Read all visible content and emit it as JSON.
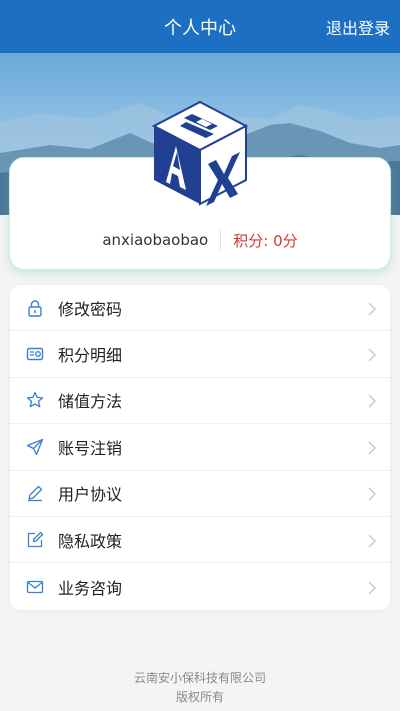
{
  "header": {
    "title": "个人中心",
    "logout_label": "退出登录",
    "bg_color": "#1d6fc3"
  },
  "profile": {
    "username": "anxiaobaobao",
    "points_label": "积分:",
    "points_value": "0分",
    "points_color": "#d23a2f"
  },
  "menu": {
    "items": [
      {
        "label": "修改密码",
        "icon": "lock-icon"
      },
      {
        "label": "积分明细",
        "icon": "card-icon"
      },
      {
        "label": "储值方法",
        "icon": "star-icon"
      },
      {
        "label": "账号注销",
        "icon": "send-icon"
      },
      {
        "label": "用户协议",
        "icon": "pen-icon"
      },
      {
        "label": "隐私政策",
        "icon": "edit-box-icon"
      },
      {
        "label": "业务咨询",
        "icon": "mail-icon"
      }
    ]
  },
  "footer": {
    "company": "云南安小保科技有限公司",
    "rights": "版权所有"
  }
}
